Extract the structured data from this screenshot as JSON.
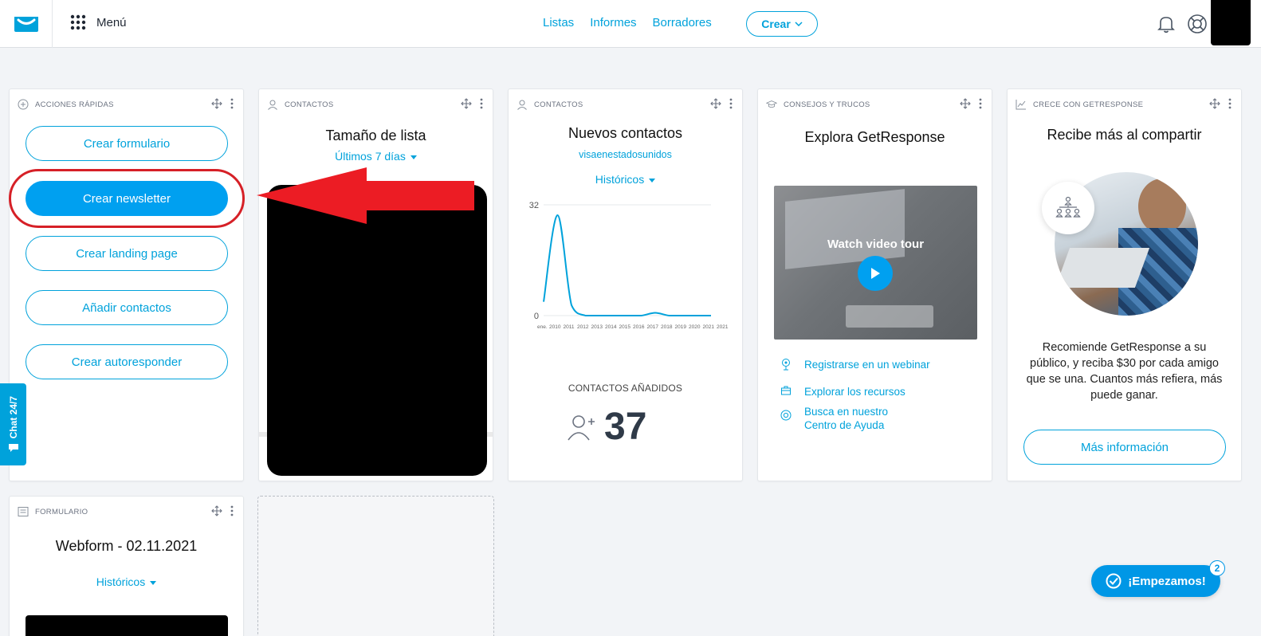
{
  "header": {
    "menu_label": "Menú",
    "nav": [
      "Listas",
      "Informes",
      "Borradores"
    ],
    "create_label": "Crear"
  },
  "quick_actions": {
    "caption": "ACCIONES RÁPIDAS",
    "buttons": [
      "Crear formulario",
      "Crear newsletter",
      "Crear landing page",
      "Añadir contactos",
      "Crear autoresponder"
    ]
  },
  "chat_tab": "Chat 24/7",
  "list_size": {
    "caption": "CONTACTOS",
    "title": "Tamaño de lista",
    "range": "Últimos 7 días"
  },
  "new_contacts": {
    "caption": "CONTACTOS",
    "title": "Nuevos contactos",
    "list_name": "visaenestadosunidos",
    "range": "Históricos",
    "added_label": "CONTACTOS AÑADIDOS",
    "added_value": "37",
    "chart_x_first_label": "ene.",
    "chart_x_labels": [
      "2010",
      "2011",
      "2012",
      "2013",
      "2014",
      "2015",
      "2016",
      "2017",
      "2018",
      "2019",
      "2020",
      "2021",
      "2021"
    ]
  },
  "chart_data": {
    "type": "line",
    "title": "",
    "xlabel": "",
    "ylabel": "",
    "ylim": [
      0,
      32
    ],
    "y_ticks": [
      "32",
      "0"
    ],
    "x": [
      "ene. 2010",
      "2011",
      "2012",
      "2013",
      "2014",
      "2015",
      "2016",
      "2017",
      "2018",
      "2019",
      "2020",
      "2021",
      "2021"
    ],
    "series": [
      {
        "values": [
          4,
          29,
          3,
          0,
          0,
          0,
          0,
          0,
          0.8,
          0,
          0,
          0,
          0
        ]
      }
    ],
    "grid": true,
    "color": "#00a2db"
  },
  "tips": {
    "caption": "CONSEJOS Y TRUCOS",
    "title": "Explora GetResponse",
    "video_label": "Watch video tour",
    "links": [
      {
        "icon": "webinar-icon",
        "text": "Registrarse en un webinar"
      },
      {
        "icon": "resources-icon",
        "text": "Explorar los recursos"
      },
      {
        "icon": "lifebuoy-icon",
        "text": "Busca en nuestro Centro de Ayuda"
      }
    ]
  },
  "referral": {
    "caption": "CRECE CON GETRESPONSE",
    "title": "Recibe más al compartir",
    "body": "Recomiende GetResponse a su público, y reciba $30 por cada amigo que se una. Cuantos más refiera, más puede ganar.",
    "button": "Más información"
  },
  "form_card": {
    "caption": "FORMULARIO",
    "title": "Webform - 02.11.2021",
    "range": "Históricos"
  },
  "onboarding": {
    "label": "¡Empezamos!",
    "badge": "2"
  },
  "colors": {
    "accent": "#00a2db",
    "primary_button": "#00a0f0",
    "highlight": "#d62027"
  }
}
